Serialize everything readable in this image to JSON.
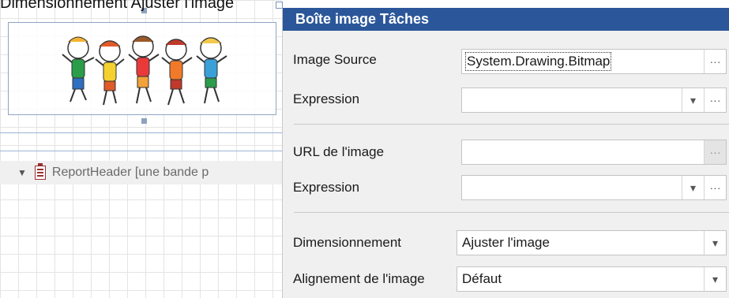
{
  "caption": "Dimensionnement Ajuster l'image",
  "designer": {
    "band_label": "ReportHeader [une bande p"
  },
  "panel": {
    "title": "Boîte image Tâches",
    "image_source_label": "Image Source",
    "image_source_value": "System.Drawing.Bitmap",
    "expression_label_1": "Expression",
    "expression_value_1": "",
    "image_url_label": "URL de l'image",
    "image_url_value": "",
    "expression_label_2": "Expression",
    "expression_value_2": "",
    "sizing_label": "Dimensionnement",
    "sizing_value": "Ajuster l'image",
    "alignment_label": "Alignement de l'image",
    "alignment_value": "Défaut"
  },
  "colors": {
    "panel_header": "#2b579a",
    "band_icon": "#9a2e2e"
  }
}
